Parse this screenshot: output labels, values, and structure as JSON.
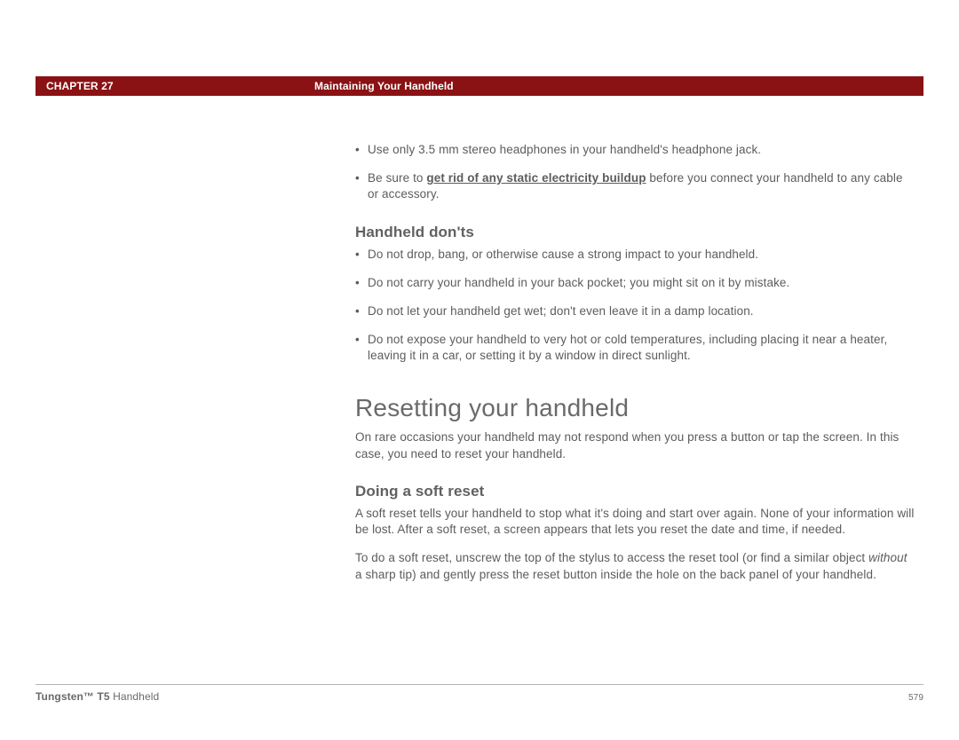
{
  "header": {
    "chapter": "CHAPTER 27",
    "title": "Maintaining Your Handheld"
  },
  "intro_bullets": [
    {
      "pre": "Use only 3.5 mm stereo headphones in your handheld's headphone jack."
    },
    {
      "pre": "Be sure to ",
      "link": "get rid of any static electricity buildup",
      "post": " before you connect your handheld to any cable or accessory."
    }
  ],
  "donts": {
    "heading": "Handheld don'ts",
    "items": [
      "Do not drop, bang, or otherwise cause a strong impact to your handheld.",
      "Do not carry your handheld in your back pocket; you might sit on it by mistake.",
      "Do not let your handheld get wet; don't even leave it in a damp location.",
      "Do not expose your handheld to very hot or cold temperatures, including placing it near a heater, leaving it in a car, or setting it by a window in direct sunlight."
    ]
  },
  "reset": {
    "heading": "Resetting your handheld",
    "intro": "On rare occasions your handheld may not respond when you press a button or tap the screen. In this case, you need to reset your handheld."
  },
  "soft": {
    "heading": "Doing a soft reset",
    "p1": "A soft reset tells your handheld to stop what it's doing and start over again. None of your information will be lost. After a soft reset, a screen appears that lets you reset the date and time, if needed.",
    "p2_pre": "To do a soft reset, unscrew the top of the stylus to access the reset tool (or find a similar object ",
    "p2_em": "without",
    "p2_post": " a sharp tip) and gently press the reset button inside the hole on the back panel of your handheld."
  },
  "footer": {
    "product_bold": "Tungsten™ T5",
    "product_rest": " Handheld",
    "page": "579"
  }
}
